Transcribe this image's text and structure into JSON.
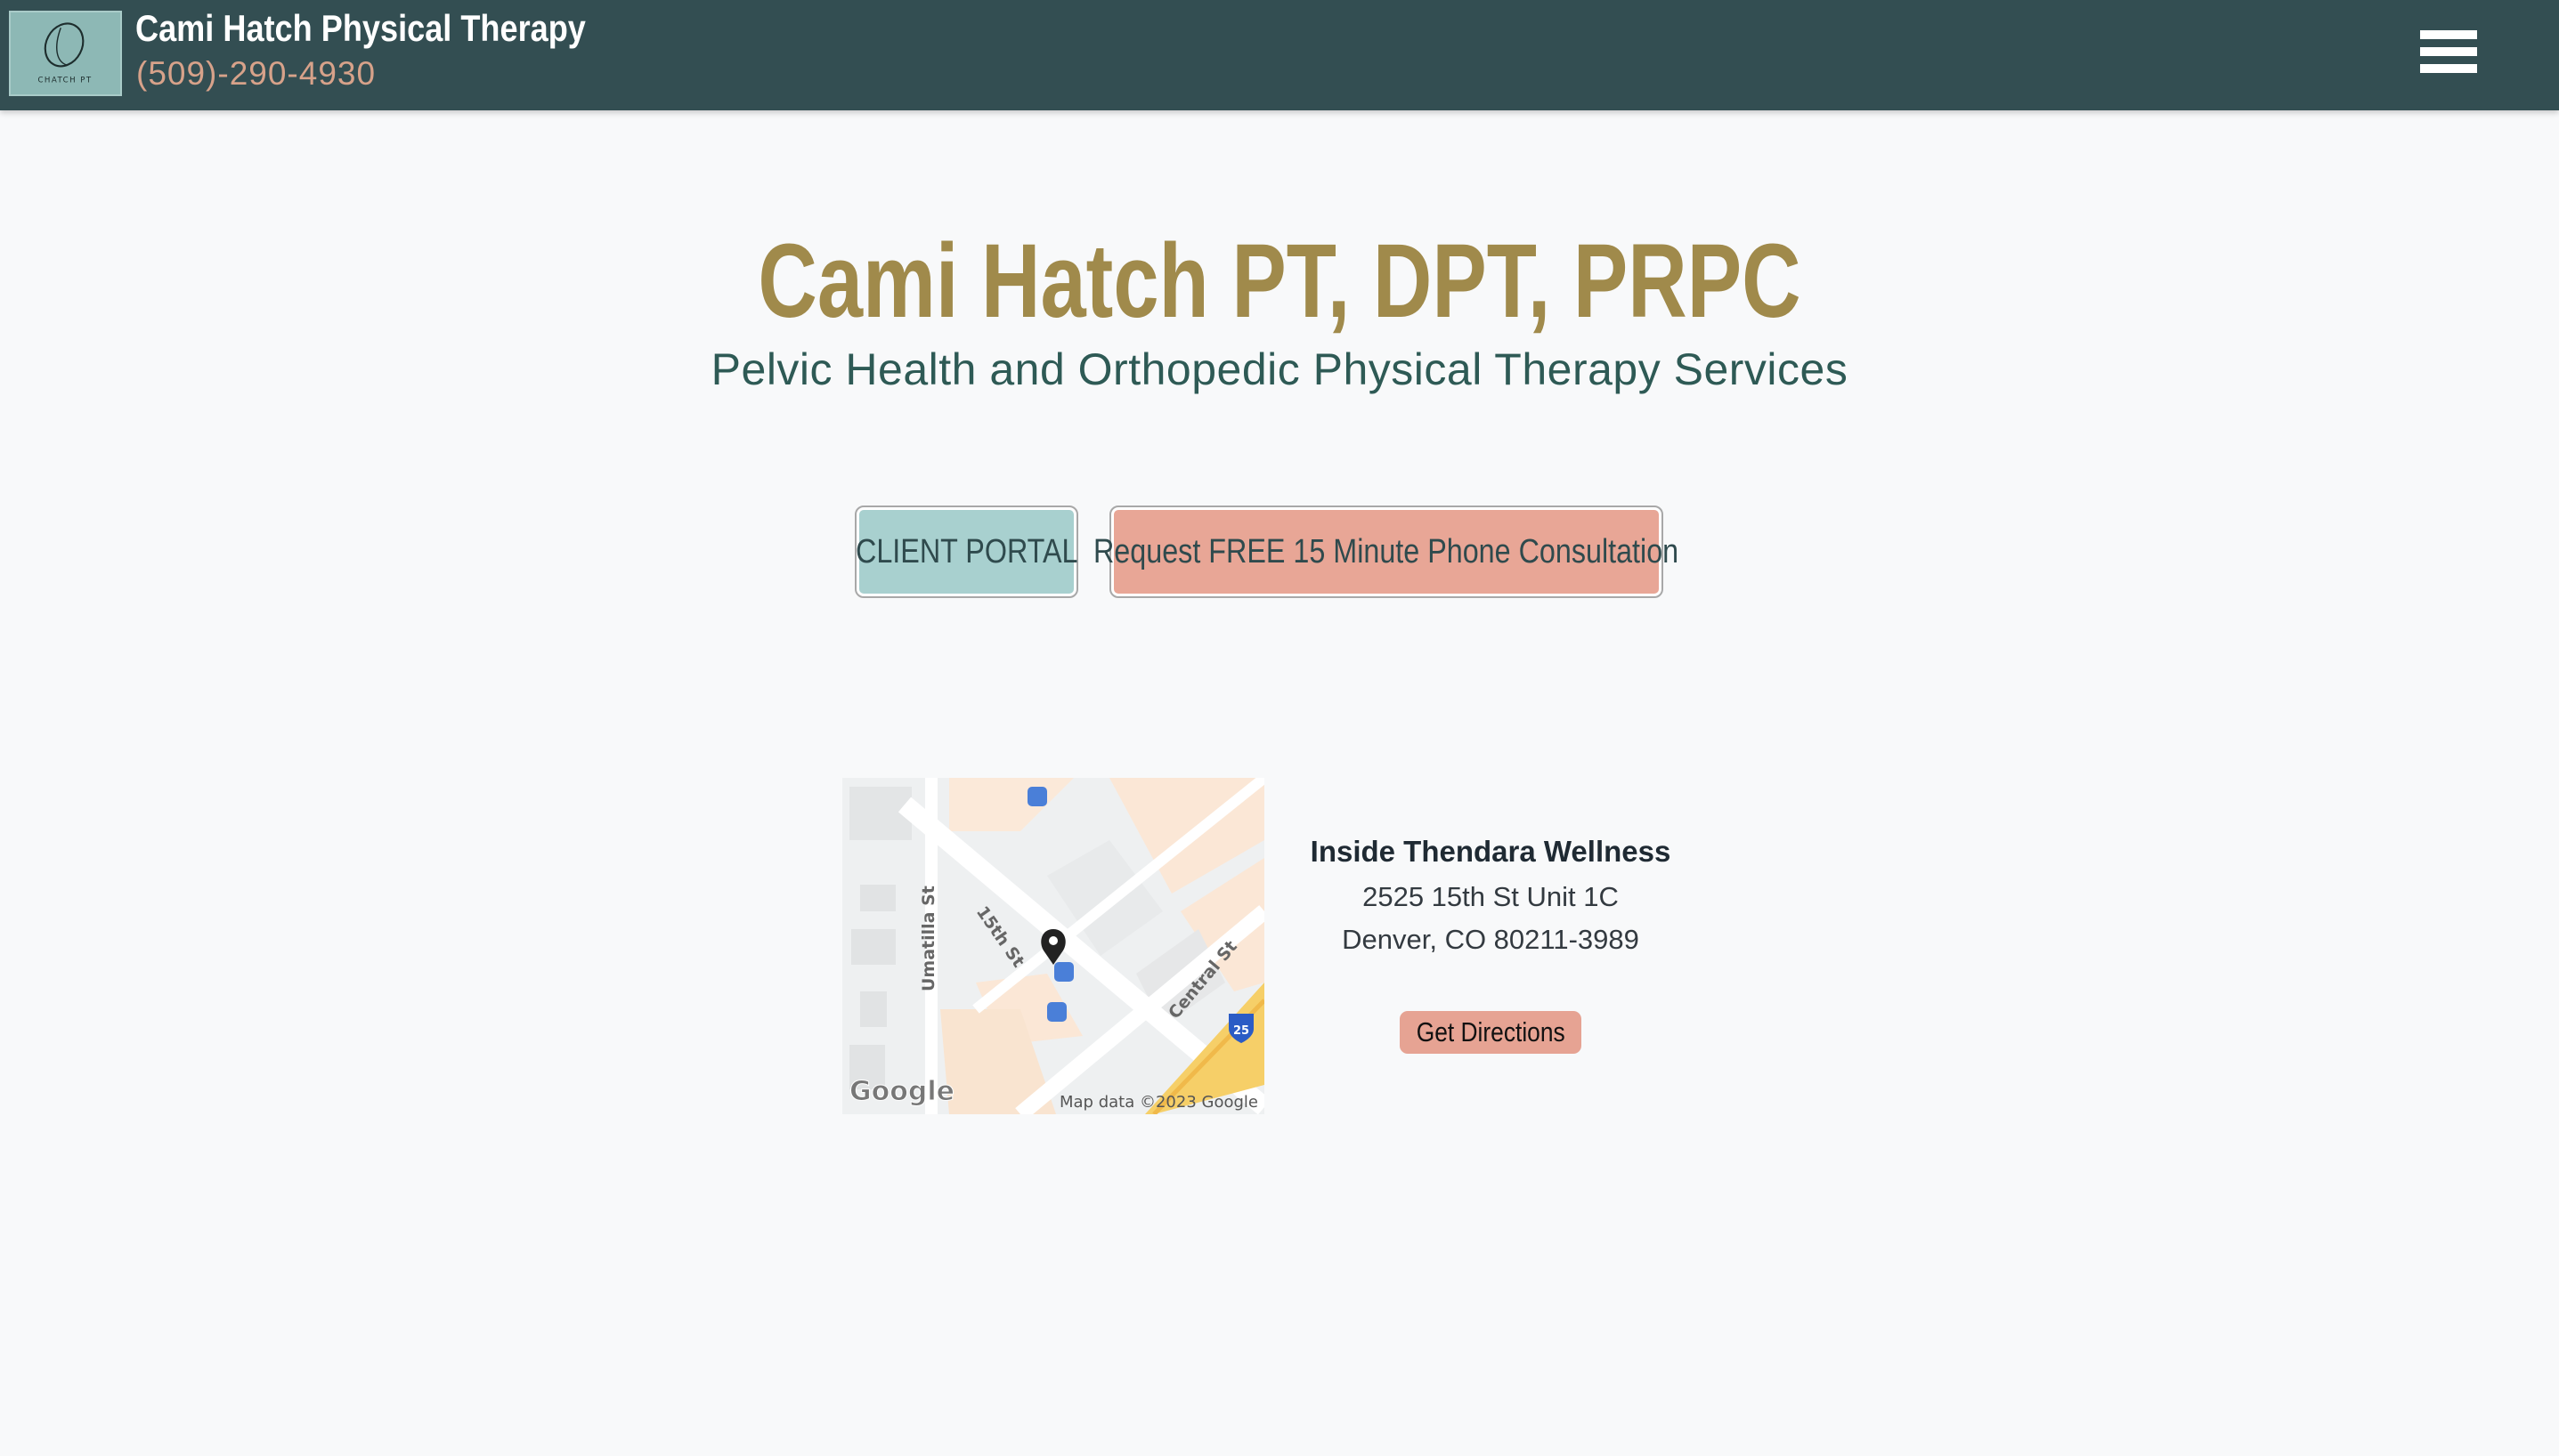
{
  "header": {
    "logo_text": "CHATCH PT",
    "brand_name": "Cami Hatch Physical Therapy",
    "phone": "(509)-290-4930"
  },
  "hero": {
    "title": "Cami Hatch PT, DPT, PRPC",
    "subtitle": "Pelvic Health and Orthopedic Physical Therapy Services"
  },
  "actions": {
    "client_portal": "CLIENT PORTAL",
    "consultation": "Request FREE 15 Minute Phone Consultation"
  },
  "map": {
    "street_labels": [
      "Umatilla St",
      "15th St",
      "Central St"
    ],
    "highway_shield": "25",
    "brand": "Google",
    "attribution": "Map data ©2023 Google"
  },
  "location": {
    "name": "Inside Thendara Wellness",
    "address_line1": "2525 15th St Unit 1C",
    "address_line2": "Denver, CO 80211-3989",
    "directions_label": "Get Directions"
  },
  "colors": {
    "header_bg": "#334e52",
    "title_gold": "#a08a4b",
    "teal_button": "#a8d0cf",
    "salmon_button": "#e8a696",
    "page_bg": "#f8f9fa"
  }
}
